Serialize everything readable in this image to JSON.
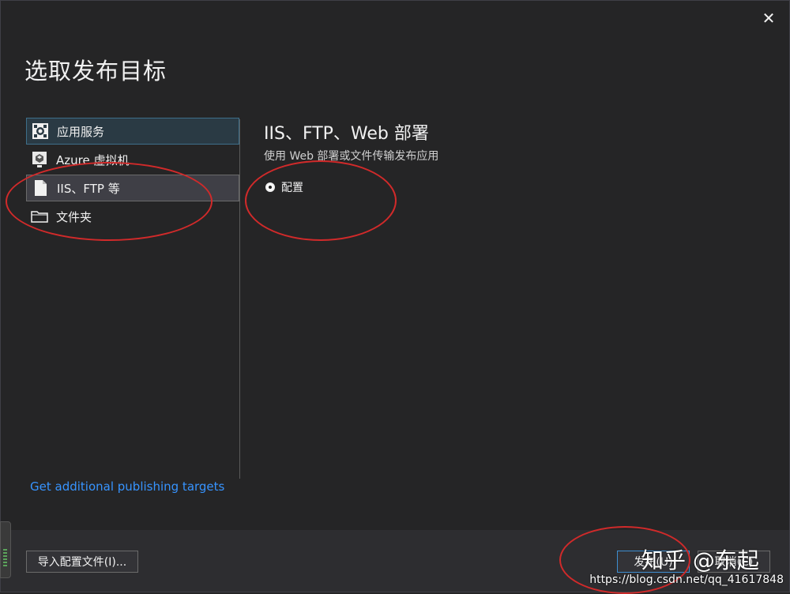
{
  "dialog": {
    "title": "选取发布目标",
    "close_glyph": "✕"
  },
  "sidebar": {
    "items": [
      {
        "label": "应用服务",
        "icon": "app-service-icon",
        "state": "active"
      },
      {
        "label": "Azure 虚拟机",
        "icon": "virtual-machine-icon",
        "state": "normal"
      },
      {
        "label": "IIS、FTP 等",
        "icon": "document-icon",
        "state": "selected"
      },
      {
        "label": "文件夹",
        "icon": "folder-icon",
        "state": "normal"
      }
    ],
    "link_label": "Get additional publishing targets"
  },
  "content": {
    "title": "IIS、FTP、Web 部署",
    "subtitle": "使用 Web 部署或文件传输发布应用",
    "radio_label": "配置"
  },
  "footer": {
    "import_label": "导入配置文件(I)...",
    "publish_label": "发布(U)",
    "cancel_label": "取消(C)"
  },
  "watermark": {
    "brand": "知乎 @东起",
    "url": "https://blog.csdn.net/qq_41617848"
  },
  "colors": {
    "background": "#252526",
    "footer": "#2d2d30",
    "link": "#3794ff",
    "annotation": "#d12a2a",
    "selected_item": "#3f3f46"
  }
}
